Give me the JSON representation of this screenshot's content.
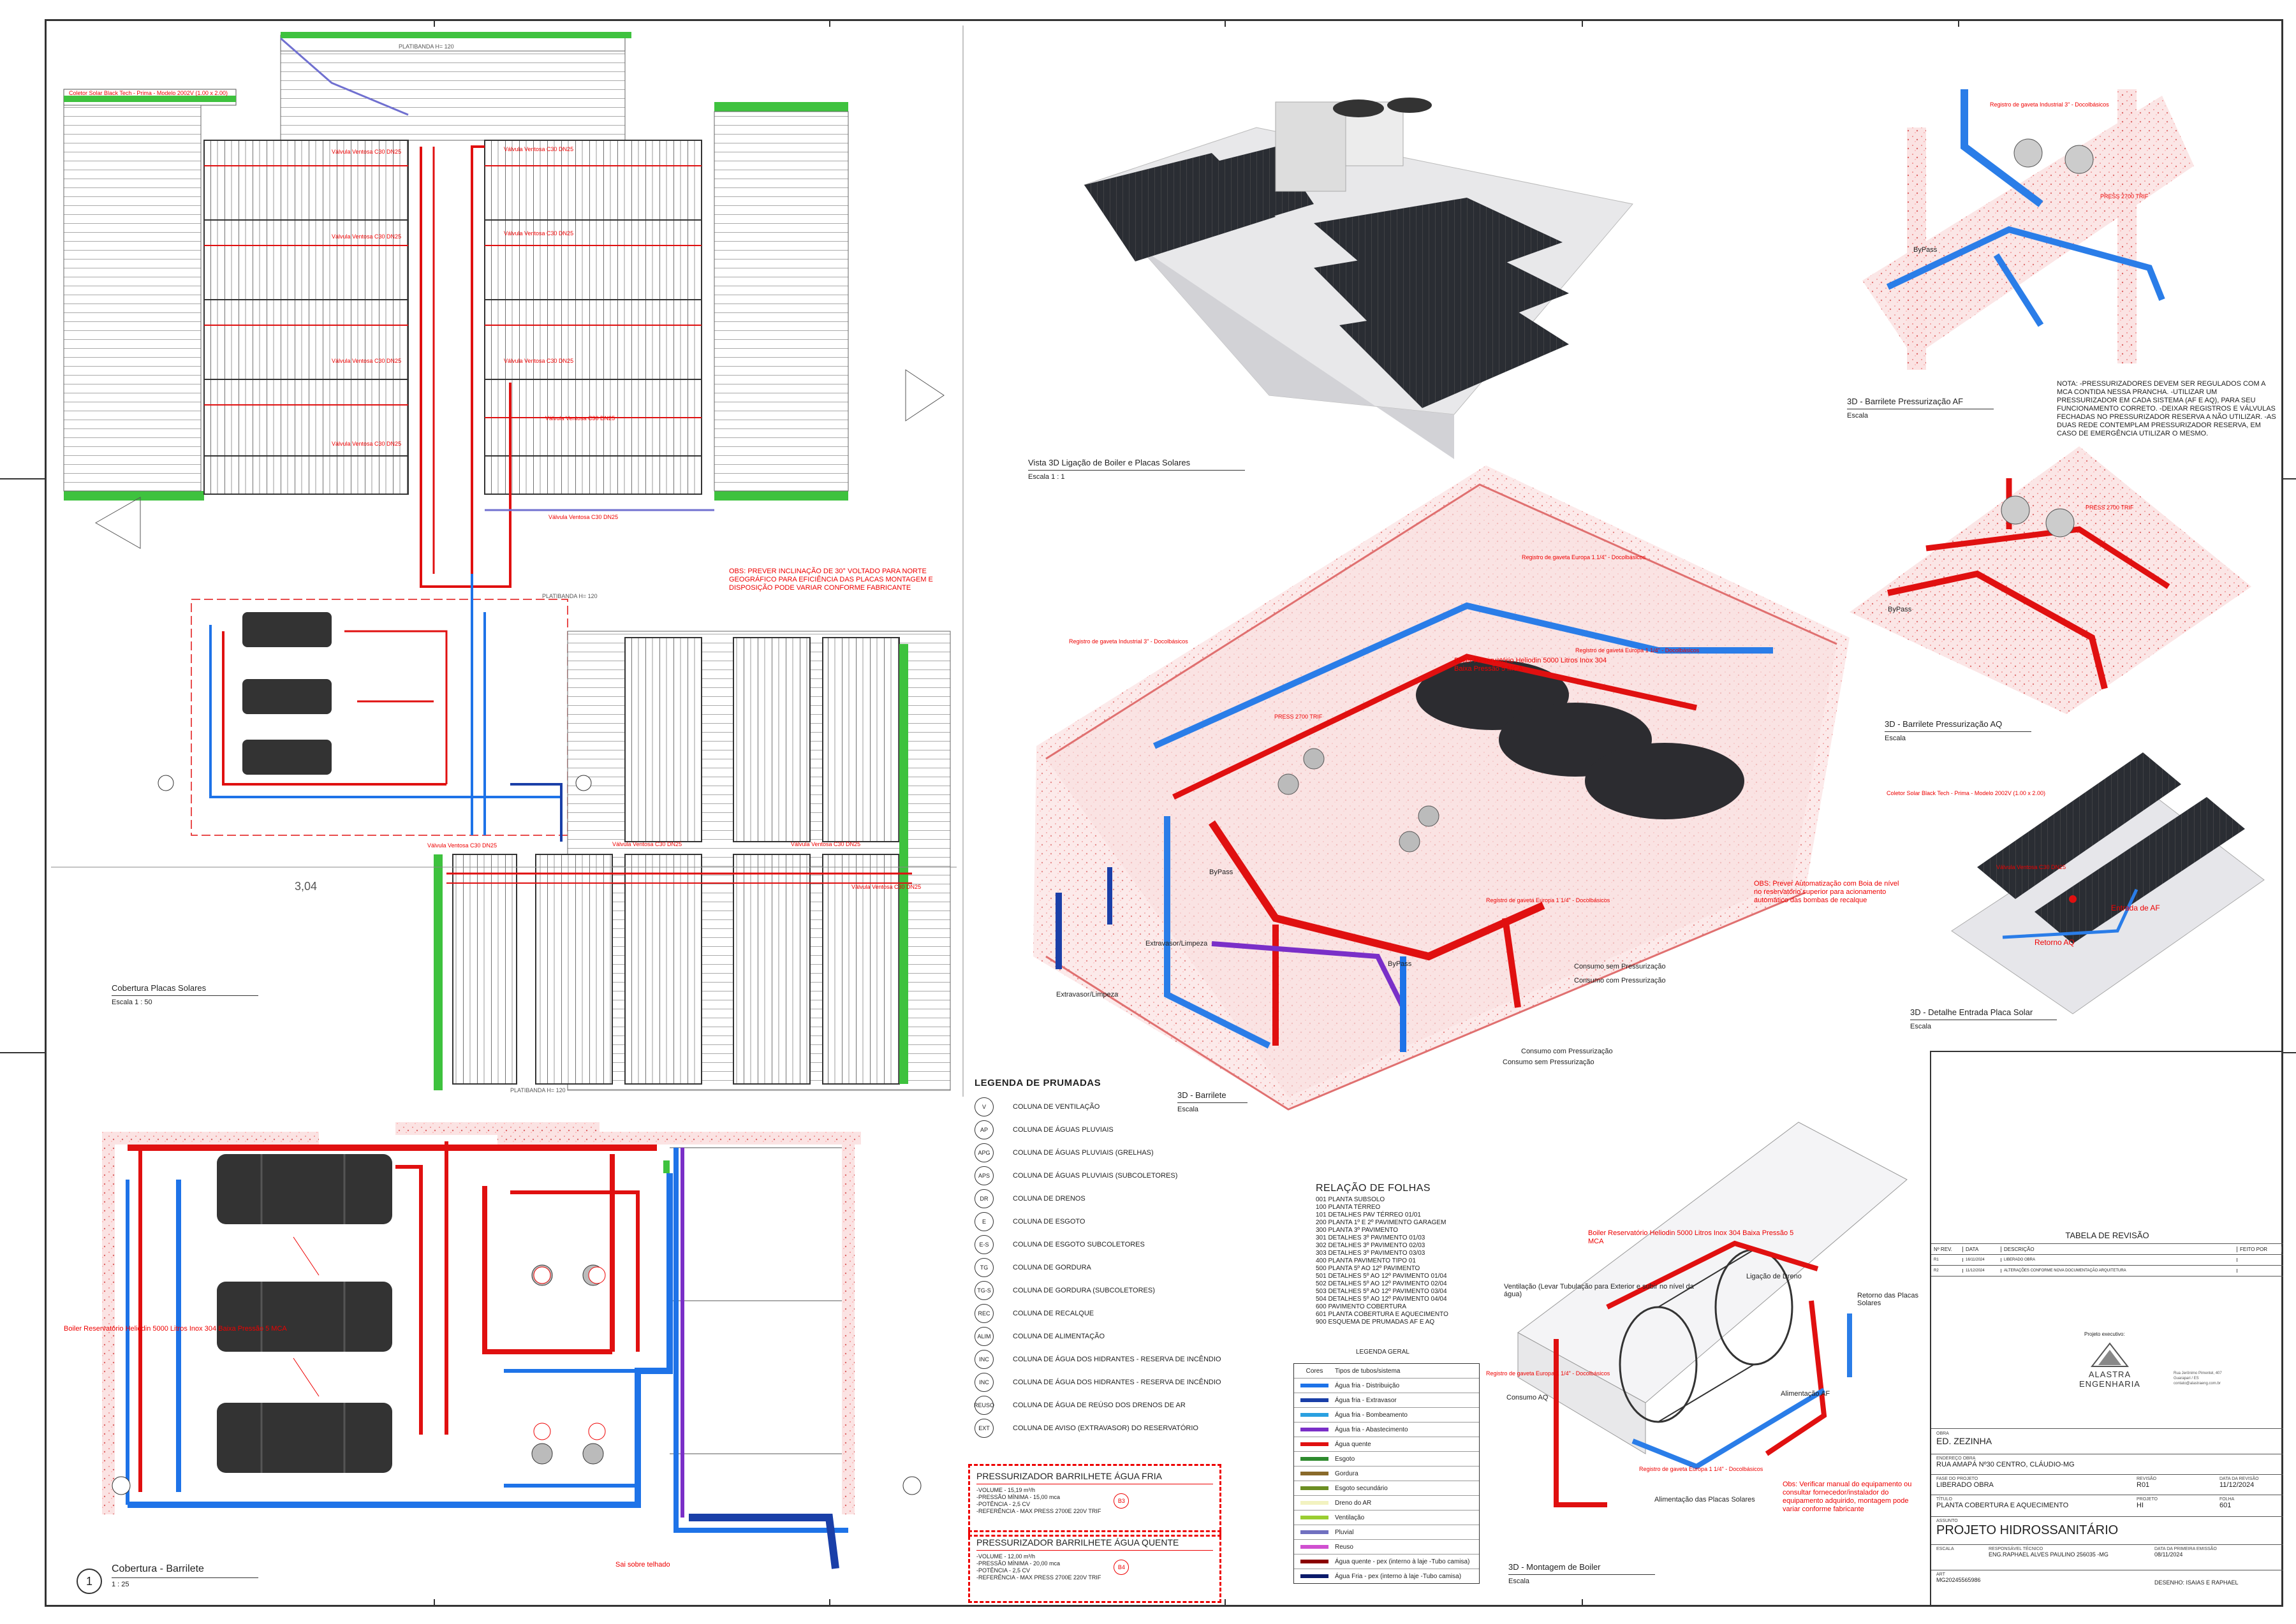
{
  "views": {
    "cobertura": {
      "title": "Cobertura Placas Solares",
      "scale": "Escala   1 : 50"
    },
    "barrilete_plan": {
      "title": "Cobertura - Barrilete",
      "number": "1",
      "scale": "1 : 25"
    },
    "vista3d": {
      "title": "Vista 3D Ligação de Boiler e Placas Solares",
      "scale": "Escala   1 : 1"
    },
    "barrilete3d": {
      "title": "3D - Barrilete",
      "scale": "Escala"
    },
    "press_af": {
      "title": "3D - Barrilete Pressurização AF",
      "scale": "Escala"
    },
    "press_aq": {
      "title": "3D - Barrilete Pressurização AQ",
      "scale": "Escala"
    },
    "placa": {
      "title": "3D - Detalhe Entrada Placa Solar",
      "scale": "Escala"
    },
    "boiler": {
      "title": "3D - Montagem de Boiler",
      "scale": "Escala"
    }
  },
  "notes": {
    "obs_solar": "OBS: PREVER INCLINAÇÃO DE 30° VOLTADO PARA NORTE GEOGRÁFICO PARA EFICIÊNCIA DAS PLACAS MONTAGEM E DISPOSIÇÃO PODE VARIAR CONFORME FABRICANTE",
    "nota_press": "NOTA: -PRESSURIZADORES DEVEM SER REGULADOS COM A MCA CONTIDA NESSA PRANCHA. -UTILIZAR UM PRESSURIZADOR EM CADA SISTEMA (AF E AQ), PARA SEU FUNCIONAMENTO CORRETO. -DEIXAR REGISTROS E VÁLVULAS FECHADAS NO PRESSURIZADOR RESERVA A NÃO UTILIZAR. -AS DUAS REDE CONTEMPLAM PRESSURIZADOR RESERVA, EM CASO DE EMERGÊNCIA UTILIZAR O MESMO.",
    "obs_boia": "OBS: Prever Automatização com Boia de nível no reservatório superior para acionamento automático das bombas de recalque",
    "obs_boiler": "Obs: Verificar manual do equipamento ou consultar fornecedor/instalador do equipamento adquirido, montagem pode variar conforme fabricante"
  },
  "labels": {
    "boiler": "Boiler Reservatório Heliodin 5000 Litros Inox 304 Baixa Pressão 5 MCA",
    "coletor": "Coletor Solar Black Tech - Prima - Modelo 2002V (1.00 x 2.00)",
    "valvula": "Válvula Ventosa C30 DN25",
    "registro_eur": "Registro de gaveta Europa 1 1/4\" - Docolbásicos",
    "registro_ind": "Registro de gaveta Industrial 3\" - Docolbásicos",
    "bypass": "ByPass",
    "extravasor": "Extravasor/Limpeza",
    "consumo_sem": "Consumo sem Pressurização",
    "consumo_com": "Consumo com Pressurização",
    "press": "PRESS 2700 TRIF",
    "entrada_af": "Entrada de AF",
    "retorno_aq": "Retorno AQ",
    "ventilacao": "Ventilação (Levar Tubulação para Exterior e subir no nível da água)",
    "dreno": "Ligação de Dreno",
    "retorno_placas": "Retorno das Placas Solares",
    "consumo_aq": "Consumo AQ",
    "alimentacao_af": "Alimentação AF",
    "alim_placas": "Alimentação das Placas Solares",
    "sai_telhado": "Sai sobre telhado",
    "platibanda": "PLATIBANDA  H= 120",
    "cota": "3,04"
  },
  "legenda_prumadas": {
    "title": "LEGENDA DE PRUMADAS",
    "items": [
      {
        "code": "V",
        "desc": "COLUNA DE VENTILAÇÃO"
      },
      {
        "code": "AP",
        "desc": "COLUNA DE ÁGUAS PLUVIAIS"
      },
      {
        "code": "APG",
        "desc": "COLUNA DE ÁGUAS PLUVIAIS (GRELHAS)"
      },
      {
        "code": "APS",
        "desc": "COLUNA DE ÁGUAS PLUVIAIS (SUBCOLETORES)"
      },
      {
        "code": "DR",
        "desc": "COLUNA DE DRENOS"
      },
      {
        "code": "E",
        "desc": "COLUNA DE ESGOTO"
      },
      {
        "code": "E-S",
        "desc": "COLUNA DE ESGOTO SUBCOLETORES"
      },
      {
        "code": "TG",
        "desc": "COLUNA DE GORDURA"
      },
      {
        "code": "TG-S",
        "desc": "COLUNA DE GORDURA (SUBCOLETORES)"
      },
      {
        "code": "REC",
        "desc": "COLUNA DE RECALQUE"
      },
      {
        "code": "ALIM",
        "desc": "COLUNA DE ALIMENTAÇÃO"
      },
      {
        "code": "INC",
        "desc": "COLUNA DE ÁGUA DOS HIDRANTES - RESERVA DE INCÊNDIO"
      },
      {
        "code": "INC",
        "desc": "COLUNA DE ÁGUA DOS HIDRANTES - RESERVA DE INCÊNDIO"
      },
      {
        "code": "REUSO",
        "desc": "COLUNA DE ÁGUA DE REÚSO DOS DRENOS DE AR"
      },
      {
        "code": "EXT",
        "desc": "COLUNA DE AVISO (EXTRAVASOR) DO RESERVATÓRIO"
      }
    ]
  },
  "pressurizador_af": {
    "title": "PRESSURIZADOR BARRILHETE ÁGUA FRIA",
    "tag": "B3",
    "lines": [
      "-VOLUME - 15,19 m³/h",
      "-PRESSÃO MÍNIMA - 15,00 mca",
      "-POTÊNCIA - 2,5 CV",
      "-REFERÊNCIA - MAX PRESS 2700E 220V TRIF"
    ]
  },
  "pressurizador_aq": {
    "title": "PRESSURIZADOR BARRILHETE ÁGUA QUENTE",
    "tag": "B4",
    "lines": [
      "-VOLUME - 12,00 m³/h",
      "-PRESSÃO MÍNIMA - 20,00 mca",
      "-POTÊNCIA - 2,5 CV",
      "-REFERÊNCIA - MAX PRESS 2700E 220V TRIF"
    ]
  },
  "relacao_folhas": {
    "title": "RELAÇÃO DE FOLHAS",
    "items": [
      "001 PLANTA SUBSOLO",
      "100 PLANTA TÉRREO",
      "101 DETALHES PAV TÉRREO 01/01",
      "200 PLANTA 1º E 2º PAVIMENTO GARAGEM",
      "300 PLANTA 3º PAVIMENTO",
      "301 DETALHES 3º PAVIMENTO 01/03",
      "302 DETALHES 3º PAVIMENTO 02/03",
      "303 DETALHES 3º PAVIMENTO 03/03",
      "400 PLANTA PAVIMENTO TIPO 01",
      "500 PLANTA 5º AO 12º PAVIMENTO",
      "501 DETALHES 5º AO 12º PAVIMENTO 01/04",
      "502 DETALHES 5º AO 12º PAVIMENTO 02/04",
      "503 DETALHES 5º AO 12º PAVIMENTO 03/04",
      "504 DETALHES 5º AO 12º PAVIMENTO 04/04",
      "600 PAVIMENTO COBERTURA",
      "601 PLANTA COBERTURA E AQUECIMENTO",
      "900 ESQUEMA DE PRUMADAS AF E AQ"
    ]
  },
  "legenda_geral": {
    "title": "LEGENDA GERAL",
    "col_a": "Cores",
    "col_b": "Tipos de tubos/sistema",
    "items": [
      {
        "color": "#1e73e8",
        "desc": "Água fria - Distribuição"
      },
      {
        "color": "#1a3fa8",
        "desc": "Água fria - Extravasor"
      },
      {
        "color": "#2aa0e0",
        "desc": "Água fria - Bombeamento"
      },
      {
        "color": "#7a2fc8",
        "desc": "Água fria - Abastecimento"
      },
      {
        "color": "#e01010",
        "desc": "Água quente"
      },
      {
        "color": "#2e8b2e",
        "desc": "Esgoto"
      },
      {
        "color": "#8a6a2a",
        "desc": "Gordura"
      },
      {
        "color": "#6b8e23",
        "desc": "Esgoto secundário"
      },
      {
        "color": "#f2f2c0",
        "desc": "Dreno do AR"
      },
      {
        "color": "#9acd32",
        "desc": "Ventilação"
      },
      {
        "color": "#7070c0",
        "desc": "Pluvial"
      },
      {
        "color": "#d050d0",
        "desc": "Reuso"
      },
      {
        "color": "#8b0000",
        "desc": "Água quente - pex (interno à laje -Tubo camisa)"
      },
      {
        "color": "#0a1a6a",
        "desc": "Água Fria - pex (interno à laje -Tubo camisa)"
      }
    ]
  },
  "tabela_revisao": {
    "title": "TABELA DE REVISÃO",
    "headers": [
      "Nº REV.",
      "DATA",
      "DESCRIÇÃO",
      "FEITO POR"
    ],
    "rows": [
      [
        "R1",
        "16/11/2024",
        "LIBERADO OBRA",
        ""
      ],
      [
        "R2",
        "11/12/2024",
        "ALTERAÇÕES CONFORME NOVA DOCUMENTAÇÃO ARQUITETURA",
        ""
      ]
    ]
  },
  "title_block": {
    "executor_label": "Projeto executivo:",
    "company": "ALASTRA ENGENHARIA",
    "company_info": [
      "Rua Jerônimo Pimentel, 407",
      "Guarapari / ES",
      "contato@alastraeng.com.br"
    ],
    "obra_label": "OBRA",
    "obra": "ED. ZEZINHA",
    "endereco_label": "ENDEREÇO OBRA",
    "endereco": "RUA AMAPÁ Nº30 CENTRO, CLÁUDIO-MG",
    "fase_label": "FASE DO PROJETO",
    "fase": "LIBERADO OBRA",
    "revisao_label": "REVISÃO",
    "revisao": "R01",
    "data_label": "DATA DA REVISÃO",
    "data": "11/12/2024",
    "titulo_label": "TÍTULO",
    "titulo": "PLANTA COBERTURA E AQUECIMENTO",
    "projeto_label": "PROJETO",
    "projeto_code": "HI",
    "folha_label": "FOLHA",
    "folha": "601",
    "assunto_label": "ASSUNTO",
    "assunto": "PROJETO HIDROSSANITÁRIO",
    "escala_label": "ESCALA",
    "resp_label": "RESPONSÁVEL TÉCNICO",
    "resp": "ENG.RAPHAEL ALVES PAULINO 256035 -MG",
    "emissao_label": "DATA DA PRIMEIRA EMISSÃO",
    "emissao": "08/11/2024",
    "art_label": "ART",
    "art": "MG20245565986",
    "desenho": "DESENHO: ISAIAS E RAPHAEL"
  }
}
